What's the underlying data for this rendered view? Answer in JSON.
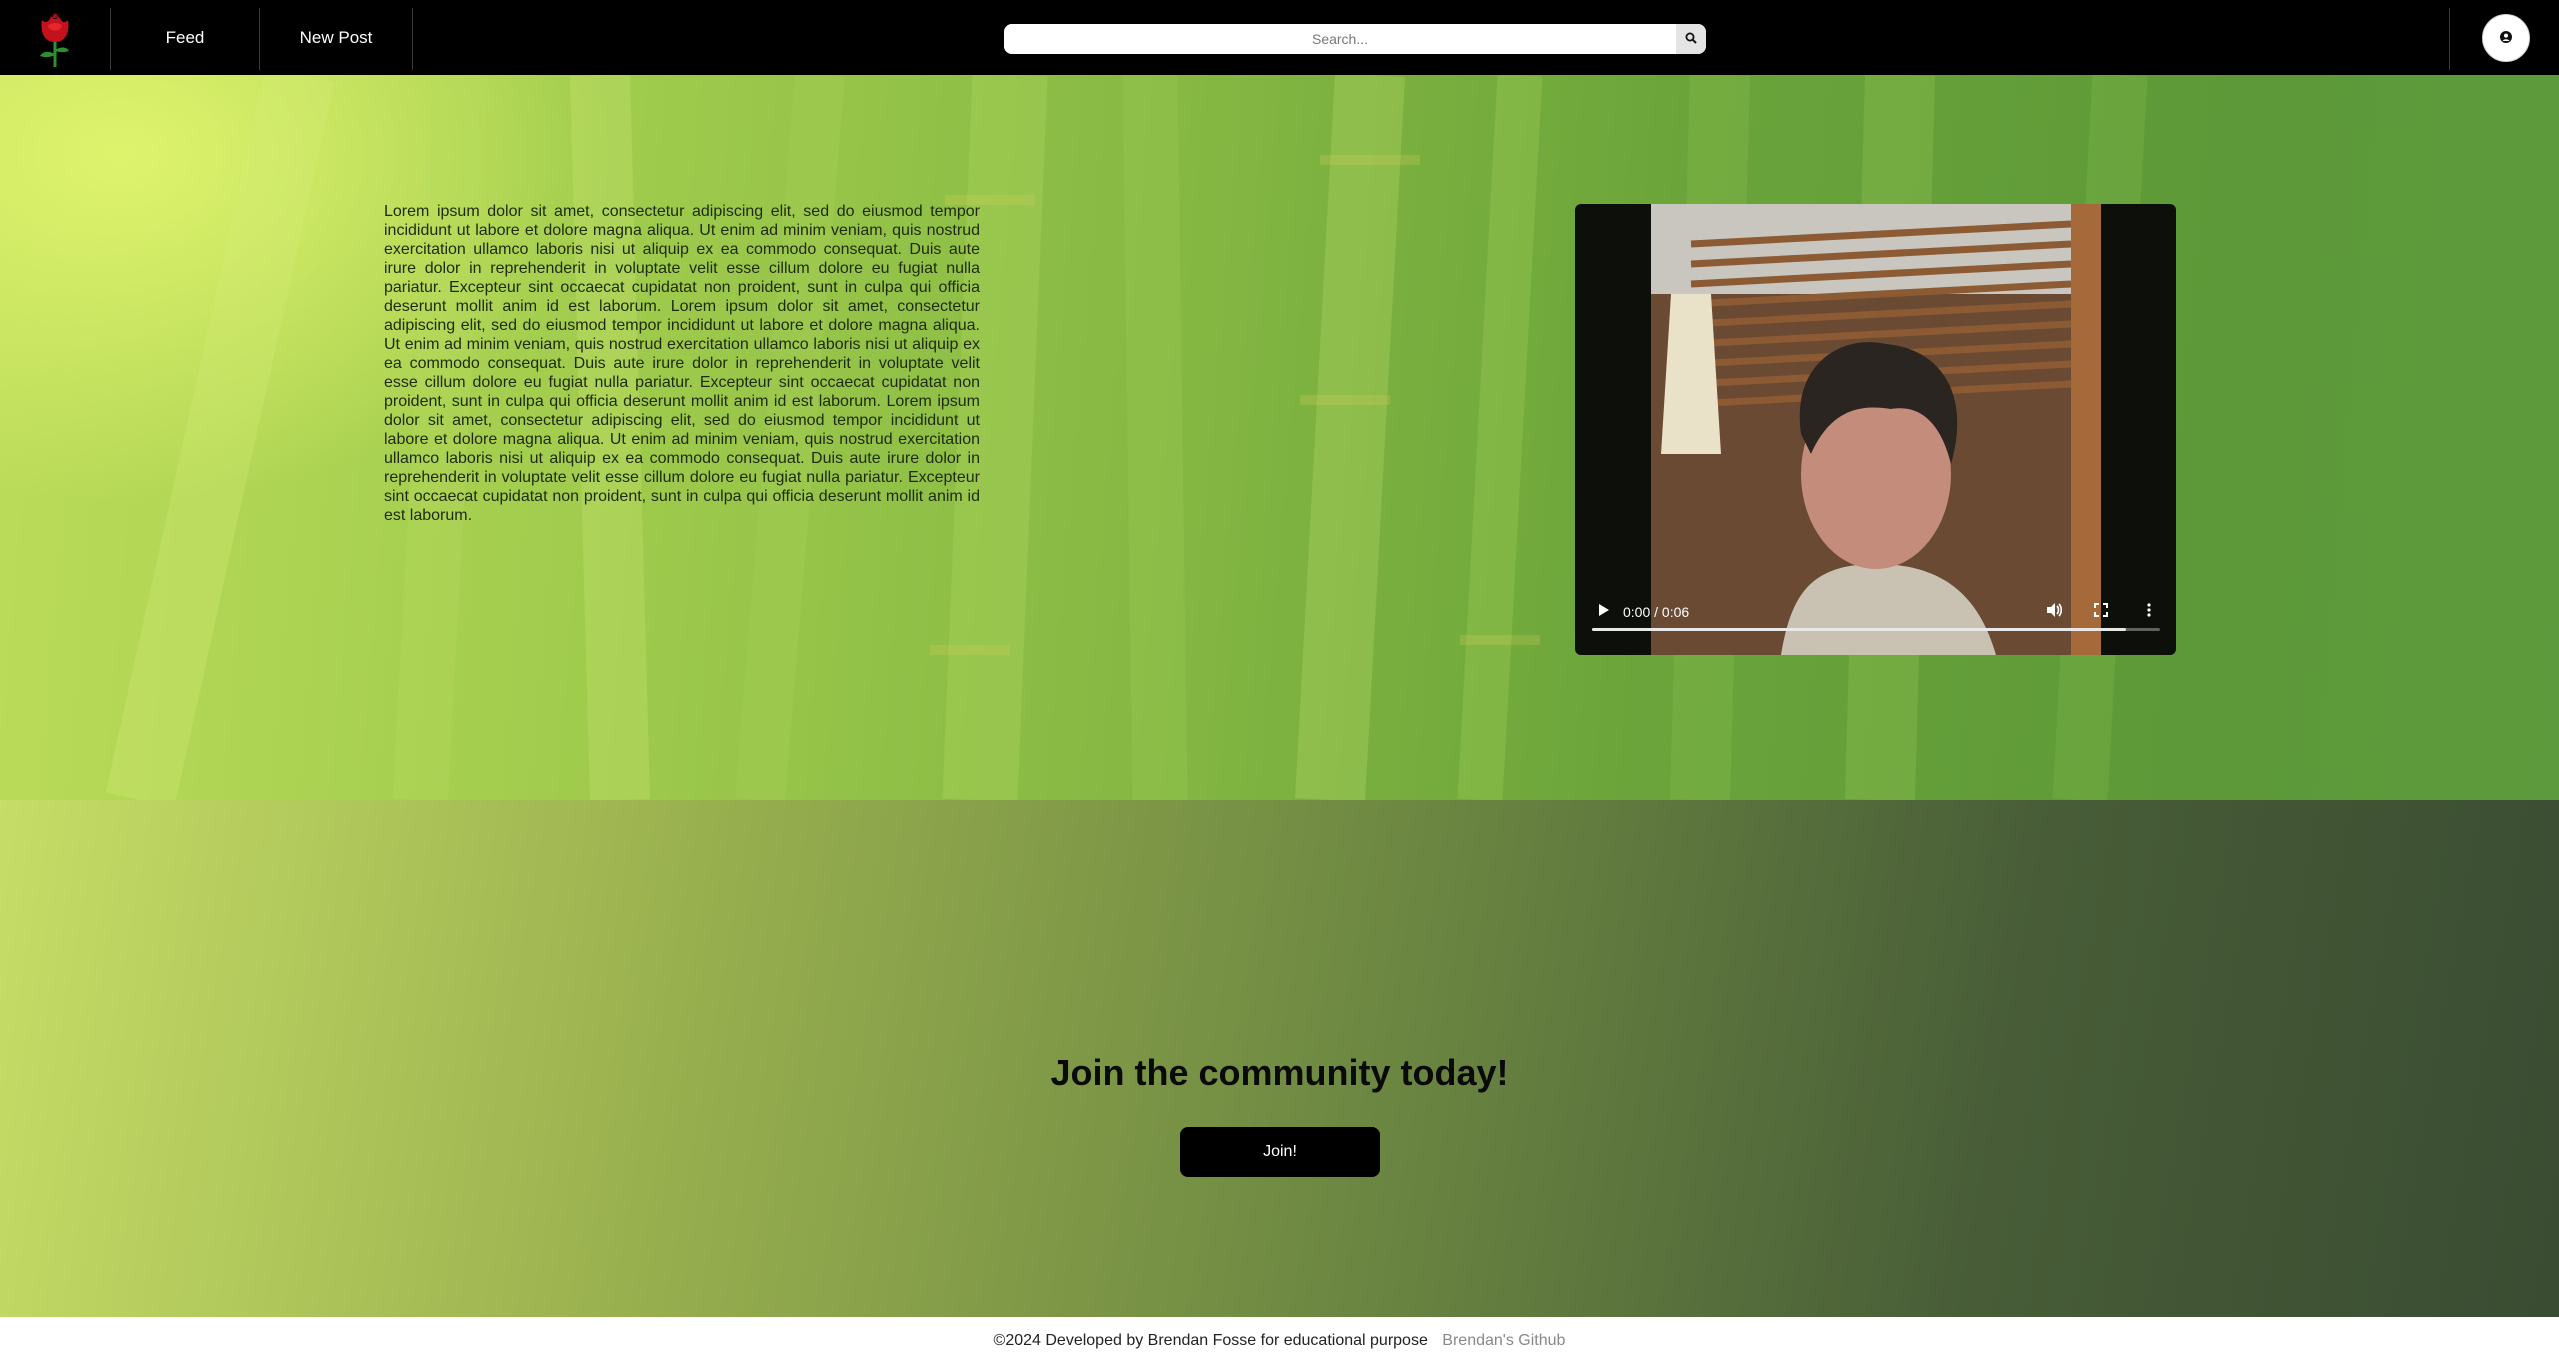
{
  "nav": {
    "logo_icon": "rose-icon",
    "feed_label": "Feed",
    "new_post_label": "New Post",
    "search_placeholder": "Search...",
    "search_icon": "magnifier-icon",
    "profile_icon": "user-circle-icon"
  },
  "hero": {
    "body_text": "Lorem ipsum dolor sit amet, consectetur adipiscing elit, sed do eiusmod tempor incididunt ut labore et dolore magna aliqua. Ut enim ad minim veniam, quis nostrud exercitation ullamco laboris nisi ut aliquip ex ea commodo consequat. Duis aute irure dolor in reprehenderit in voluptate velit esse cillum dolore eu fugiat nulla pariatur. Excepteur sint occaecat cupidatat non proident, sunt in culpa qui officia deserunt mollit anim id est laborum. Lorem ipsum dolor sit amet, consectetur adipiscing elit, sed do eiusmod tempor incididunt ut labore et dolore magna aliqua. Ut enim ad minim veniam, quis nostrud exercitation ullamco laboris nisi ut aliquip ex ea commodo consequat. Duis aute irure dolor in reprehenderit in voluptate velit esse cillum dolore eu fugiat nulla pariatur. Excepteur sint occaecat cupidatat non proident, sunt in culpa qui officia deserunt mollit anim id est laborum. Lorem ipsum dolor sit amet, consectetur adipiscing elit, sed do eiusmod tempor incididunt ut labore et dolore magna aliqua. Ut enim ad minim veniam, quis nostrud exercitation ullamco laboris nisi ut aliquip ex ea commodo consequat. Duis aute irure dolor in reprehenderit in voluptate velit esse cillum dolore eu fugiat nulla pariatur. Excepteur sint occaecat cupidatat non proident, sunt in culpa qui officia deserunt mollit anim id est laborum.",
    "video": {
      "time_display": "0:00 / 0:06",
      "progress_fraction": 0.94,
      "play_icon": "play-icon",
      "volume_icon": "volume-icon",
      "fullscreen_icon": "fullscreen-icon",
      "more_icon": "more-vertical-icon"
    }
  },
  "join": {
    "title": "Join the community today!",
    "button_label": "Join!"
  },
  "footer": {
    "copyright": "©2024 Developed by Brendan Fosse for educational purpose",
    "github_link": "Brendan's Github"
  },
  "colors": {
    "navbar_bg": "#000000",
    "button_bg": "#000000",
    "footer_link": "#888888"
  }
}
